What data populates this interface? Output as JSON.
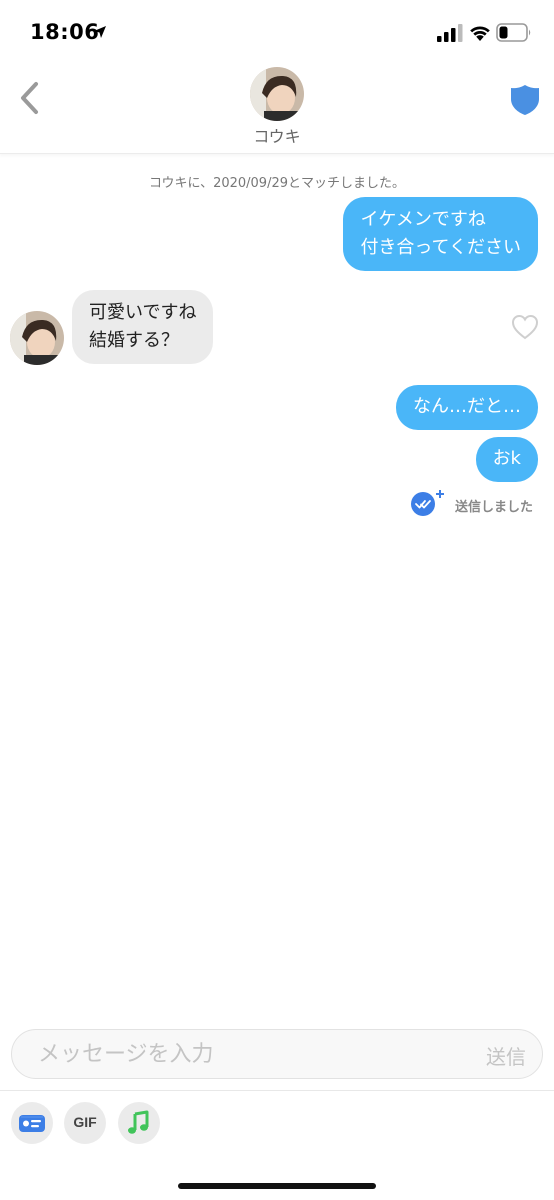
{
  "status_bar": {
    "time": "18:06",
    "icons": [
      "location-arrow-icon",
      "signal-icon",
      "wifi-icon",
      "battery-icon"
    ]
  },
  "header": {
    "name": "コウキ",
    "back_icon": "chevron-left-icon",
    "safety_icon": "shield-icon",
    "accent_color": "#4a90e2"
  },
  "chat": {
    "match_note": "コウキに、2020/09/29とマッチしました。",
    "messages": [
      {
        "from": "me",
        "text": "イケメンですね\n付き合ってください"
      },
      {
        "from": "them",
        "text": "可愛いですね\n結婚する？"
      },
      {
        "from": "me",
        "text": "なん…だと…"
      },
      {
        "from": "me",
        "text": "おk"
      }
    ],
    "sent_status": "送信しました",
    "bubble_out_color": "#4ab6f8",
    "bubble_in_color": "#ebebeb"
  },
  "composer": {
    "placeholder": "メッセージを入力",
    "send_label": "送信",
    "tools": {
      "card_icon": "contact-card-icon",
      "gif_label": "GIF",
      "music_icon": "music-note-icon"
    }
  }
}
